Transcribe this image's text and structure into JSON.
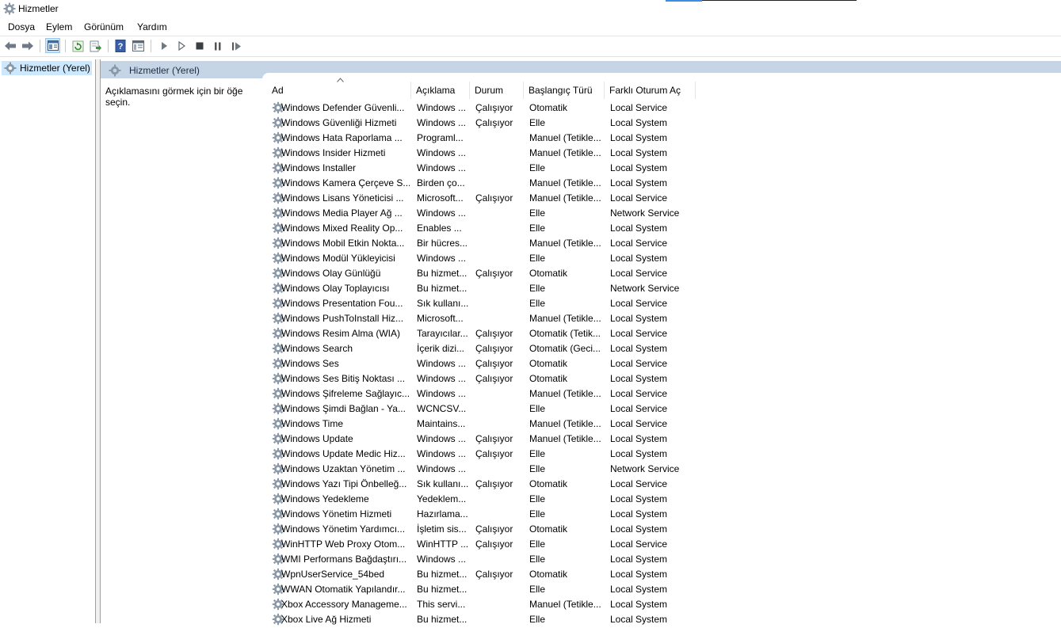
{
  "window": {
    "title": "Hizmetler"
  },
  "menu": [
    "Dosya",
    "Eylem",
    "Görünüm",
    "Yardım"
  ],
  "tree": {
    "selected_label": "Hizmetler (Yerel)"
  },
  "pane": {
    "header_title": "Hizmetler (Yerel)",
    "description": "Açıklamasını görmek için bir öğe seçin."
  },
  "columns": [
    "Ad",
    "Açıklama",
    "Durum",
    "Başlangıç Türü",
    "Farklı Oturum Aç"
  ],
  "services": [
    [
      "Windows Defender Güvenli...",
      "Windows ...",
      "Çalışıyor",
      "Otomatik",
      "Local Service"
    ],
    [
      "Windows Güvenliği Hizmeti",
      "Windows ...",
      "Çalışıyor",
      "Elle",
      "Local System"
    ],
    [
      "Windows Hata Raporlama ...",
      "Programl...",
      "",
      "Manuel (Tetikle...",
      "Local System"
    ],
    [
      "Windows Insider Hizmeti",
      "Windows ...",
      "",
      "Manuel (Tetikle...",
      "Local System"
    ],
    [
      "Windows Installer",
      "Windows ...",
      "",
      "Elle",
      "Local System"
    ],
    [
      "Windows Kamera Çerçeve S...",
      "Birden ço...",
      "",
      "Manuel (Tetikle...",
      "Local System"
    ],
    [
      "Windows Lisans Yöneticisi ...",
      "Microsoft...",
      "Çalışıyor",
      "Manuel (Tetikle...",
      "Local Service"
    ],
    [
      "Windows Media Player Ağ ...",
      "Windows ...",
      "",
      "Elle",
      "Network Service"
    ],
    [
      "Windows Mixed Reality Op...",
      "Enables ...",
      "",
      "Elle",
      "Local System"
    ],
    [
      "Windows Mobil Etkin Nokta...",
      "Bir hücres...",
      "",
      "Manuel (Tetikle...",
      "Local Service"
    ],
    [
      "Windows Modül Yükleyicisi",
      "Windows ...",
      "",
      "Elle",
      "Local System"
    ],
    [
      "Windows Olay Günlüğü",
      "Bu hizmet...",
      "Çalışıyor",
      "Otomatik",
      "Local Service"
    ],
    [
      "Windows Olay Toplayıcısı",
      "Bu hizmet...",
      "",
      "Elle",
      "Network Service"
    ],
    [
      "Windows Presentation Fou...",
      "Sık kullanı...",
      "",
      "Elle",
      "Local Service"
    ],
    [
      "Windows PushToInstall Hiz...",
      "Microsoft...",
      "",
      "Manuel (Tetikle...",
      "Local System"
    ],
    [
      "Windows Resim Alma (WIA)",
      "Tarayıcılar...",
      "Çalışıyor",
      "Otomatik (Tetik...",
      "Local Service"
    ],
    [
      "Windows Search",
      "İçerik dizi...",
      "Çalışıyor",
      "Otomatik (Geci...",
      "Local System"
    ],
    [
      "Windows Ses",
      "Windows ...",
      "Çalışıyor",
      "Otomatik",
      "Local Service"
    ],
    [
      "Windows Ses Bitiş Noktası ...",
      "Windows ...",
      "Çalışıyor",
      "Otomatik",
      "Local System"
    ],
    [
      "Windows Şifreleme Sağlayıc...",
      "Windows ...",
      "",
      "Manuel (Tetikle...",
      "Local Service"
    ],
    [
      "Windows Şimdi Bağlan - Ya...",
      "WCNCSV...",
      "",
      "Elle",
      "Local Service"
    ],
    [
      "Windows Time",
      "Maintains...",
      "",
      "Manuel (Tetikle...",
      "Local Service"
    ],
    [
      "Windows Update",
      "Windows ...",
      "Çalışıyor",
      "Manuel (Tetikle...",
      "Local System"
    ],
    [
      "Windows Update Medic Hiz...",
      "Windows ...",
      "Çalışıyor",
      "Elle",
      "Local System"
    ],
    [
      "Windows Uzaktan Yönetim ...",
      "Windows ...",
      "",
      "Elle",
      "Network Service"
    ],
    [
      "Windows Yazı Tipi Önbelleğ...",
      "Sık kullanı...",
      "Çalışıyor",
      "Otomatik",
      "Local Service"
    ],
    [
      "Windows Yedekleme",
      "Yedeklem...",
      "",
      "Elle",
      "Local System"
    ],
    [
      "Windows Yönetim Hizmeti",
      "Hazırlama...",
      "",
      "Elle",
      "Local System"
    ],
    [
      "Windows Yönetim Yardımcı...",
      "İşletim sis...",
      "Çalışıyor",
      "Otomatik",
      "Local System"
    ],
    [
      "WinHTTP Web Proxy Otom...",
      "WinHTTP ...",
      "Çalışıyor",
      "Elle",
      "Local Service"
    ],
    [
      "WMI Performans Bağdaştırı...",
      "Windows ...",
      "",
      "Elle",
      "Local System"
    ],
    [
      "WpnUserService_54bed",
      "Bu hizmet...",
      "Çalışıyor",
      "Otomatik",
      "Local System"
    ],
    [
      "WWAN Otomatik Yapılandır...",
      "Bu hizmet...",
      "",
      "Elle",
      "Local System"
    ],
    [
      "Xbox Accessory Manageme...",
      "This servi...",
      "",
      "Manuel (Tetikle...",
      "Local System"
    ],
    [
      "Xbox Live Ağ Hizmeti",
      "Bu hizmet...",
      "",
      "Elle",
      "Local System"
    ]
  ]
}
